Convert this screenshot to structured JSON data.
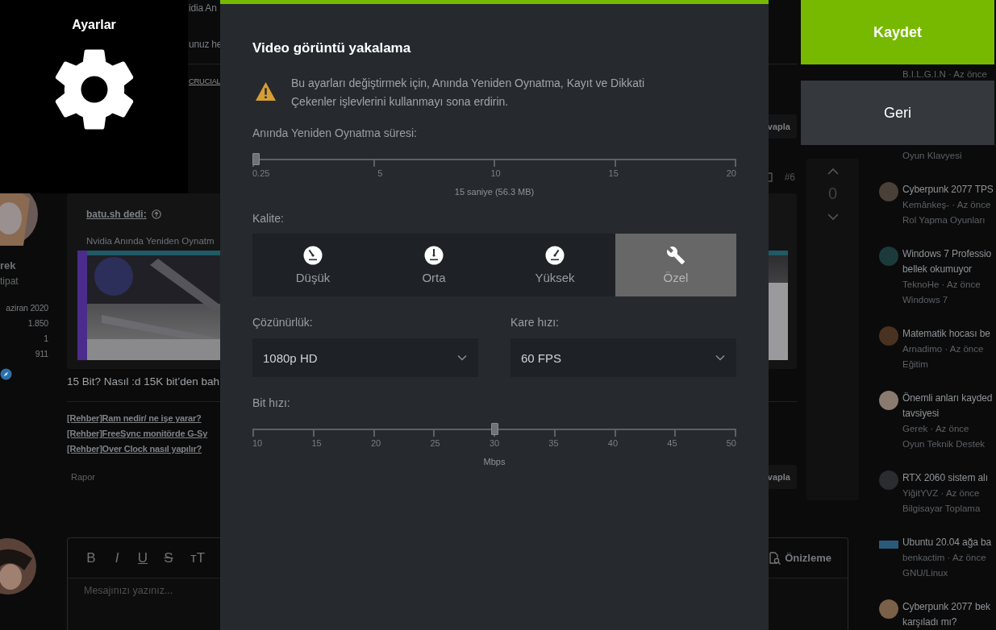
{
  "settings_panel": {
    "title": "Ayarlar"
  },
  "dialog": {
    "title": "Video görüntü yakalama",
    "warning": "Bu ayarları değiştirmek için, Anında Yeniden Oynatma, Kayıt ve Dikkati Çekenler işlevlerini kullanmayı sona erdirin.",
    "replay_duration": {
      "label": "Anında Yeniden Oynatma süresi:",
      "ticks": [
        "0.25",
        "5",
        "10",
        "15",
        "20"
      ],
      "level": 0,
      "reading": "15 saniye (56.3 MB)"
    },
    "quality": {
      "label": "Kalite:",
      "options": [
        {
          "label": "Düşük",
          "kind": "gauge-low",
          "selected": false
        },
        {
          "label": "Orta",
          "kind": "gauge-medium",
          "selected": false
        },
        {
          "label": "Yüksek",
          "kind": "gauge-high",
          "selected": false
        },
        {
          "label": "Özel",
          "kind": "custom",
          "selected": true
        }
      ]
    },
    "resolution": {
      "label": "Çözünürlük:",
      "value": "1080p HD"
    },
    "frame_rate": {
      "label": "Kare hızı:",
      "value": "60 FPS"
    },
    "bitrate": {
      "label": "Bit hızı:",
      "ticks": [
        "10",
        "15",
        "20",
        "25",
        "30",
        "35",
        "40",
        "45",
        "50"
      ],
      "level": 0.5,
      "reading": "Mbps"
    }
  },
  "buttons": [
    {
      "label": "Kaydet",
      "kind": "primary"
    },
    {
      "label": "Geri",
      "kind": "secondary"
    }
  ],
  "forum": {
    "previous_post": {
      "lines": [
        "idia An",
        "unuz he"
      ],
      "link": "CRUCIAL",
      "reply": "vapla"
    },
    "post": {
      "author": {
        "name": "rek",
        "role": "tipat",
        "joined": "aziran 2020",
        "stats": [
          "1.850",
          "1",
          "911"
        ]
      },
      "number": "#6",
      "quote": {
        "author": "batu.sh dedi:",
        "text": "Nvidia Anında Yeniden Oynatm"
      },
      "body": "15 Bit? Nasıl :d 15K bit’den bah",
      "signature": [
        "[Rehber]Ram nedir/ ne işe yarar?",
        "[Rehber]FreeSync monitörde G-Sy",
        "[Rehber]Over Clock nasıl yapılır?"
      ],
      "report": "Rapor",
      "reply": "vapla",
      "score": "0"
    },
    "editor": {
      "tools": [
        {
          "label": "B",
          "kind": "bold"
        },
        {
          "label": "I",
          "kind": "italic"
        },
        {
          "label": "U",
          "kind": "underline"
        },
        {
          "label": "S",
          "kind": "strike"
        },
        {
          "label": "ᴛT",
          "kind": "size"
        }
      ],
      "placeholder": "Mesajınızı yazınız...",
      "preview": "Önizleme"
    },
    "sidebar": [
      {
        "meta": "B.I.L.G.I.N · Az önce"
      },
      {
        "category": "Oyun Klavyesi"
      },
      {
        "title": [
          "Cyberpunk 2077 TPS"
        ],
        "meta": "Kemânkeş- · Az önce",
        "category": "Rol Yapma Oyunları",
        "color": "#4a4038"
      },
      {
        "title": [
          "Windows 7 Professio",
          "bellek okumuyor"
        ],
        "meta": "TeknoHe · Az önce",
        "category": "Windows 7",
        "color": "#1c3a3c"
      },
      {
        "title": [
          "Matematik hocası be"
        ],
        "meta": "Arnadimo · Az önce",
        "category": "Eğitim",
        "color": "#4a3220"
      },
      {
        "title": [
          "Önemli anları kayded",
          "tavsiyesi"
        ],
        "meta": "Gerek · Az önce",
        "category": "Oyun Teknik Destek",
        "color": "#8a7a70"
      },
      {
        "title": [
          "RTX 2060 sistem alı"
        ],
        "meta": "YiğitYVZ · Az önce",
        "category": "Bilgisayar Toplama",
        "color": "#2a2c30"
      },
      {
        "title": [
          "Ubuntu 20.04 ağa ba"
        ],
        "meta": "benkactim · Az önce",
        "category": "GNU/Linux",
        "kind": "logo",
        "color": "#2a5a7a"
      },
      {
        "title": [
          "Cyberpunk 2077 bek",
          "karşıladı mı?"
        ],
        "color": "#7a6048"
      }
    ]
  }
}
